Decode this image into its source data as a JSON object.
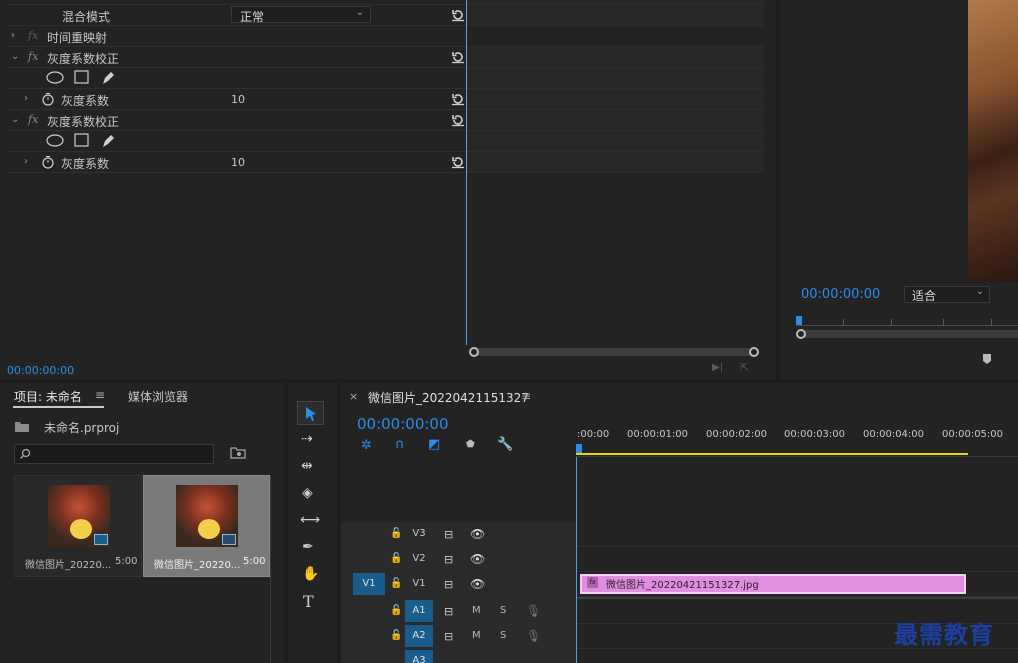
{
  "effect_controls": {
    "blend_label": "混合模式",
    "blend_value": "正常",
    "time_remap": "时间重映射",
    "gamma_effect_1": "灰度系数校正",
    "gamma_param_1": "灰度系数",
    "gamma_value_1": "10",
    "gamma_effect_2": "灰度系数校正",
    "gamma_param_2": "灰度系数",
    "gamma_value_2": "10",
    "timecode": "00:00:00:00",
    "fx_label": "fx"
  },
  "program": {
    "timecode": "00:00:00:00",
    "fit_option": "适合"
  },
  "project": {
    "tab_project": "项目: 未命名",
    "tab_media": "媒体浏览器",
    "file_name": "未命名.prproj",
    "items": [
      {
        "name": "微信图片_20220...",
        "duration": "5:00"
      },
      {
        "name": "微信图片_20220...",
        "duration": "5:00"
      }
    ]
  },
  "timeline": {
    "sequence_name": "微信图片_20220421151327",
    "timecode": "00:00:00:00",
    "ruler": [
      ":00:00",
      "00:00:01:00",
      "00:00:02:00",
      "00:00:03:00",
      "00:00:04:00",
      "00:00:05:00"
    ],
    "tracks": [
      {
        "source": "",
        "name": "V3",
        "type": "video"
      },
      {
        "source": "",
        "name": "V2",
        "type": "video"
      },
      {
        "source": "V1",
        "name": "V1",
        "type": "video"
      },
      {
        "source": "",
        "name": "A1",
        "type": "audio"
      },
      {
        "source": "",
        "name": "A2",
        "type": "audio"
      },
      {
        "source": "",
        "name": "A3",
        "type": "audio"
      }
    ],
    "mute_label": "M",
    "solo_label": "S",
    "clip_name": "微信图片_20220421151327.jpg",
    "clip_fx": "fx"
  },
  "watermark": "最需教育",
  "colors": {
    "accent": "#2d8ceb",
    "clip": "#e08fe0",
    "playhead": "#4d9ee8",
    "workarea": "#e6d800"
  }
}
